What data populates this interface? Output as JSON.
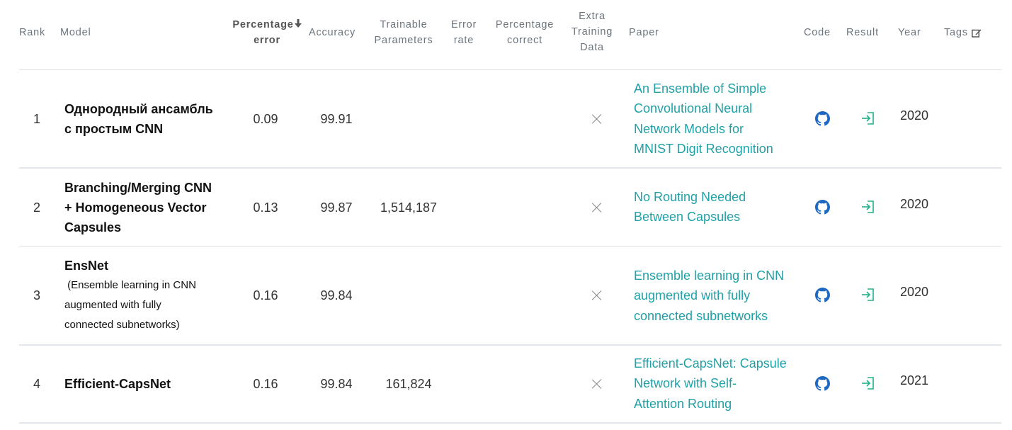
{
  "headers": {
    "rank": "Rank",
    "model": "Model",
    "percentage_error_1": "Percentage",
    "percentage_error_2": "error",
    "accuracy": "Accuracy",
    "trainable_1": "Trainable",
    "trainable_2": "Parameters",
    "error_rate_1": "Error",
    "error_rate_2": "rate",
    "pct_correct_1": "Percentage",
    "pct_correct_2": "correct",
    "extra_1": "Extra",
    "extra_2": "Training",
    "extra_3": "Data",
    "paper": "Paper",
    "code": "Code",
    "result": "Result",
    "year": "Year",
    "tags": "Tags"
  },
  "rows": [
    {
      "rank": "1",
      "model_1": "Однородный ансамбль",
      "model_2": "с простым CNN",
      "percentage_error": "0.09",
      "accuracy": "99.91",
      "trainable_parameters": "",
      "paper_lines": [
        "An Ensemble of Simple",
        "Convolutional Neural",
        "Network Models for",
        "MNIST Digit Recognition"
      ],
      "year": "2020"
    },
    {
      "rank": "2",
      "model_1": "Branching/Merging CNN",
      "model_2": "+ Homogeneous Vector",
      "model_3": "Capsules",
      "percentage_error": "0.13",
      "accuracy": "99.87",
      "trainable_parameters": "1,514,187",
      "paper_lines": [
        "No Routing Needed",
        "Between Capsules"
      ],
      "year": "2020"
    },
    {
      "rank": "3",
      "model_1": "EnsNet",
      "model_sub_1": " (Ensemble learning in CNN",
      "model_sub_2": "augmented with fully",
      "model_sub_3": "connected subnetworks)",
      "percentage_error": "0.16",
      "accuracy": "99.84",
      "trainable_parameters": "",
      "paper_lines": [
        "Ensemble learning in CNN",
        "augmented with fully",
        "connected subnetworks"
      ],
      "year": "2020"
    },
    {
      "rank": "4",
      "model_1": "Efficient-CapsNet",
      "percentage_error": "0.16",
      "accuracy": "99.84",
      "trainable_parameters": "161,824",
      "paper_lines": [
        "Efficient-CapsNet: Capsule",
        "Network with Self-",
        "Attention Routing"
      ],
      "year": "2021"
    }
  ],
  "icons": {
    "sort": "sort-down-arrow-icon",
    "tags_edit": "edit-icon",
    "no_extra_data": "cross-icon",
    "code": "github-icon",
    "result": "sign-in-arrow-icon"
  },
  "colors": {
    "paper_link": "#21a1a7",
    "github": "#1f68c2",
    "result": "#21b08b"
  }
}
